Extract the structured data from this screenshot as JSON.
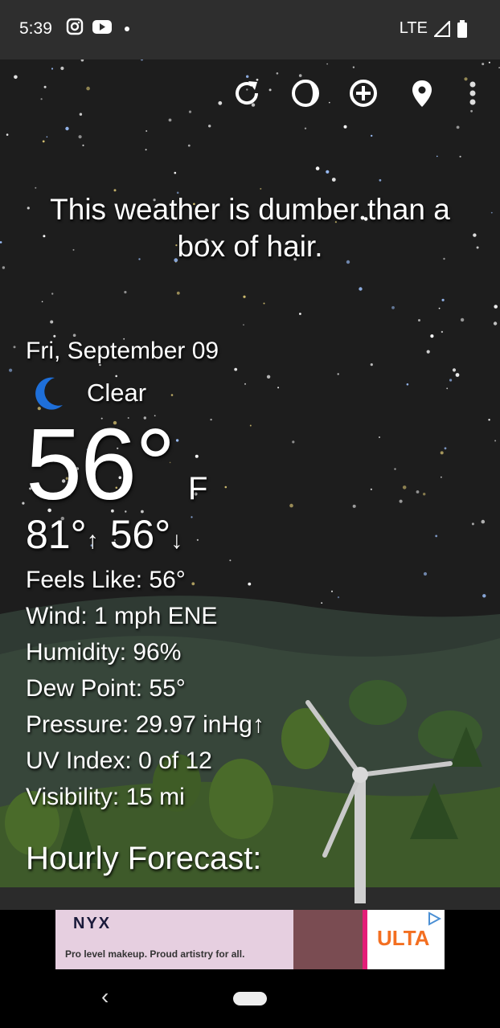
{
  "status_bar": {
    "time": "5:39",
    "network": "LTE"
  },
  "toolbar": {
    "icons": [
      "refresh-icon",
      "moon-phase-icon",
      "add-circle-icon",
      "location-pin-icon",
      "more-vert-icon"
    ]
  },
  "quote": "This weather is dumber than a box of hair.",
  "weather": {
    "date": "Fri, September 09",
    "condition": "Clear",
    "temperature": "56°",
    "unit": "F",
    "high": "81°",
    "high_arrow": "↑",
    "low": "56°",
    "low_arrow": "↓",
    "details": [
      "Feels Like:  56°",
      "Wind:  1 mph ENE",
      "Humidity:  96%",
      "Dew Point:  55°",
      "Pressure:  29.97 inHg↑",
      "UV Index:  0 of 12",
      "Visibility:  15 mi"
    ]
  },
  "hourly_title": "Hourly Forecast:",
  "ad": {
    "brand": "NYX",
    "tagline": "Pro level makeup. Proud artistry for all.",
    "partner": "ULTA"
  },
  "colors": {
    "moon": "#1e6fd9",
    "accent": "#ffffff"
  }
}
